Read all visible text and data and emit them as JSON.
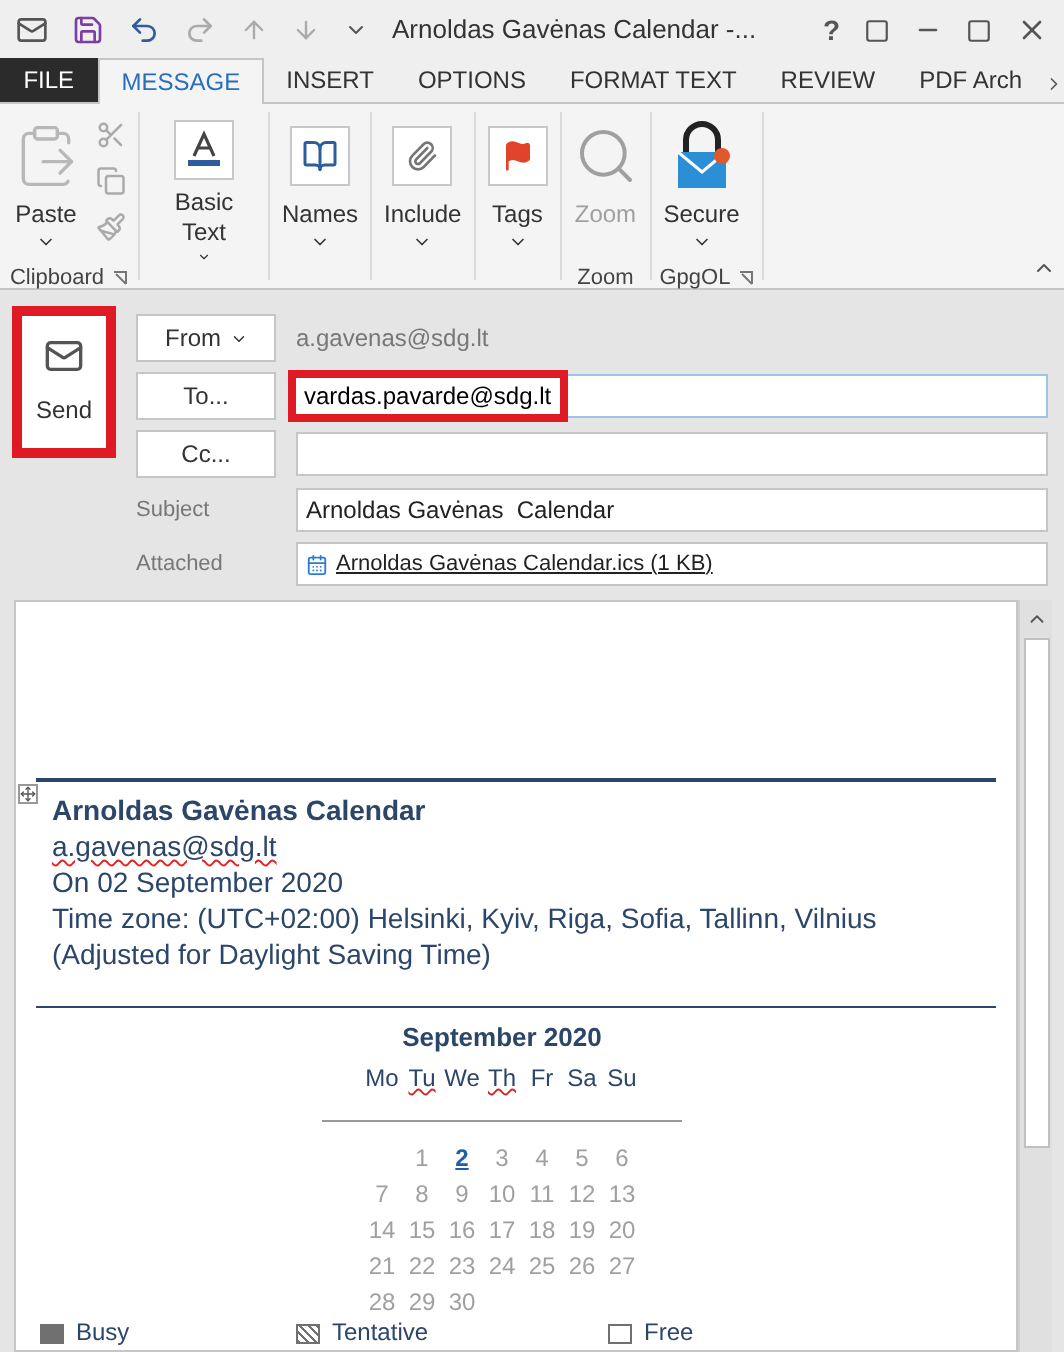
{
  "window": {
    "title": "Arnoldas Gavėnas  Calendar -...",
    "help": "?"
  },
  "tabs": [
    {
      "label": "FILE",
      "kind": "file",
      "selected": false
    },
    {
      "label": "MESSAGE",
      "kind": "tab",
      "selected": true
    },
    {
      "label": "INSERT",
      "kind": "tab",
      "selected": false
    },
    {
      "label": "OPTIONS",
      "kind": "tab",
      "selected": false
    },
    {
      "label": "FORMAT TEXT",
      "kind": "tab",
      "selected": false
    },
    {
      "label": "REVIEW",
      "kind": "tab",
      "selected": false
    },
    {
      "label": "PDF Arch",
      "kind": "tab",
      "selected": false
    }
  ],
  "ribbon": {
    "groups": [
      {
        "label": "Clipboard",
        "launcher": true,
        "buttons": [
          {
            "label": "Paste",
            "kind": "paste",
            "dropdown": true,
            "disabled": false
          }
        ]
      },
      {
        "buttons": [
          {
            "label": "Basic Text",
            "kind": "text",
            "dropdown": true,
            "disabled": false
          }
        ]
      },
      {
        "buttons": [
          {
            "label": "Names",
            "kind": "names",
            "dropdown": true,
            "disabled": false
          }
        ]
      },
      {
        "buttons": [
          {
            "label": "Include",
            "kind": "include",
            "dropdown": true,
            "disabled": false
          }
        ]
      },
      {
        "buttons": [
          {
            "label": "Tags",
            "kind": "tags",
            "dropdown": true,
            "disabled": false
          }
        ]
      },
      {
        "label": "Zoom",
        "launcher": false,
        "buttons": [
          {
            "label": "Zoom",
            "kind": "zoom",
            "dropdown": false,
            "disabled": true
          }
        ]
      },
      {
        "label": "GpgOL",
        "launcher": true,
        "buttons": [
          {
            "label": "Secure",
            "kind": "secure",
            "dropdown": true,
            "disabled": false
          }
        ]
      }
    ]
  },
  "send": {
    "label": "Send",
    "highlighted": true
  },
  "header": {
    "from": {
      "label": "From",
      "address": "a.gavenas@sdg.lt"
    },
    "to": {
      "label": "To...",
      "value": "vardas.pavarde@sdg.lt",
      "highlighted": true
    },
    "cc": {
      "label": "Cc..."
    },
    "subject": {
      "label": "Subject",
      "value": "Arnoldas Gavėnas  Calendar"
    },
    "attached": {
      "label": "Attached",
      "file": "Arnoldas Gavėnas  Calendar.ics (1 KB)"
    }
  },
  "body": {
    "title": "Arnoldas Gavėnas Calendar",
    "lines": [
      {
        "text": "a.gavenas@sdg.lt",
        "misspelled": true
      },
      {
        "text": "On 02 September 2020",
        "misspelled": false
      },
      {
        "text": "Time zone: (UTC+02:00) Helsinki, Kyiv, Riga, Sofia, Tallinn, Vilnius",
        "misspelled": false
      },
      {
        "text": "(Adjusted for Daylight Saving Time)",
        "misspelled": false
      }
    ],
    "calendar": {
      "month": "September 2020",
      "weekdays": [
        {
          "text": "Mo",
          "misspelled": false
        },
        {
          "text": "Tu",
          "misspelled": true
        },
        {
          "text": "We",
          "misspelled": false
        },
        {
          "text": "Th",
          "misspelled": true
        },
        {
          "text": "Fr",
          "misspelled": false
        },
        {
          "text": "Sa",
          "misspelled": false
        },
        {
          "text": "Su",
          "misspelled": false
        }
      ],
      "weeks": [
        [
          {
            "text": "1",
            "selected": false
          },
          {
            "text": "2",
            "selected": true
          },
          {
            "text": "3",
            "selected": false
          },
          {
            "text": "4",
            "selected": false
          },
          {
            "text": "5",
            "selected": false
          },
          {
            "text": "6",
            "selected": false
          }
        ],
        [
          {
            "text": "7",
            "selected": false
          },
          {
            "text": "8",
            "selected": false
          },
          {
            "text": "9",
            "selected": false
          },
          {
            "text": "10",
            "selected": false
          },
          {
            "text": "11",
            "selected": false
          },
          {
            "text": "12",
            "selected": false
          },
          {
            "text": "13",
            "selected": false
          }
        ],
        [
          {
            "text": "14",
            "selected": false
          },
          {
            "text": "15",
            "selected": false
          },
          {
            "text": "16",
            "selected": false
          },
          {
            "text": "17",
            "selected": false
          },
          {
            "text": "18",
            "selected": false
          },
          {
            "text": "19",
            "selected": false
          },
          {
            "text": "20",
            "selected": false
          }
        ],
        [
          {
            "text": "21",
            "selected": false
          },
          {
            "text": "22",
            "selected": false
          },
          {
            "text": "23",
            "selected": false
          },
          {
            "text": "24",
            "selected": false
          },
          {
            "text": "25",
            "selected": false
          },
          {
            "text": "26",
            "selected": false
          },
          {
            "text": "27",
            "selected": false
          }
        ],
        [
          {
            "text": "28",
            "selected": false
          },
          {
            "text": "29",
            "selected": false
          },
          {
            "text": "30",
            "selected": false
          }
        ]
      ]
    },
    "legend": [
      {
        "label": "Busy",
        "kind": "busy"
      },
      {
        "label": "Tentative",
        "kind": "tentative"
      },
      {
        "label": "Free",
        "kind": "free"
      }
    ]
  }
}
